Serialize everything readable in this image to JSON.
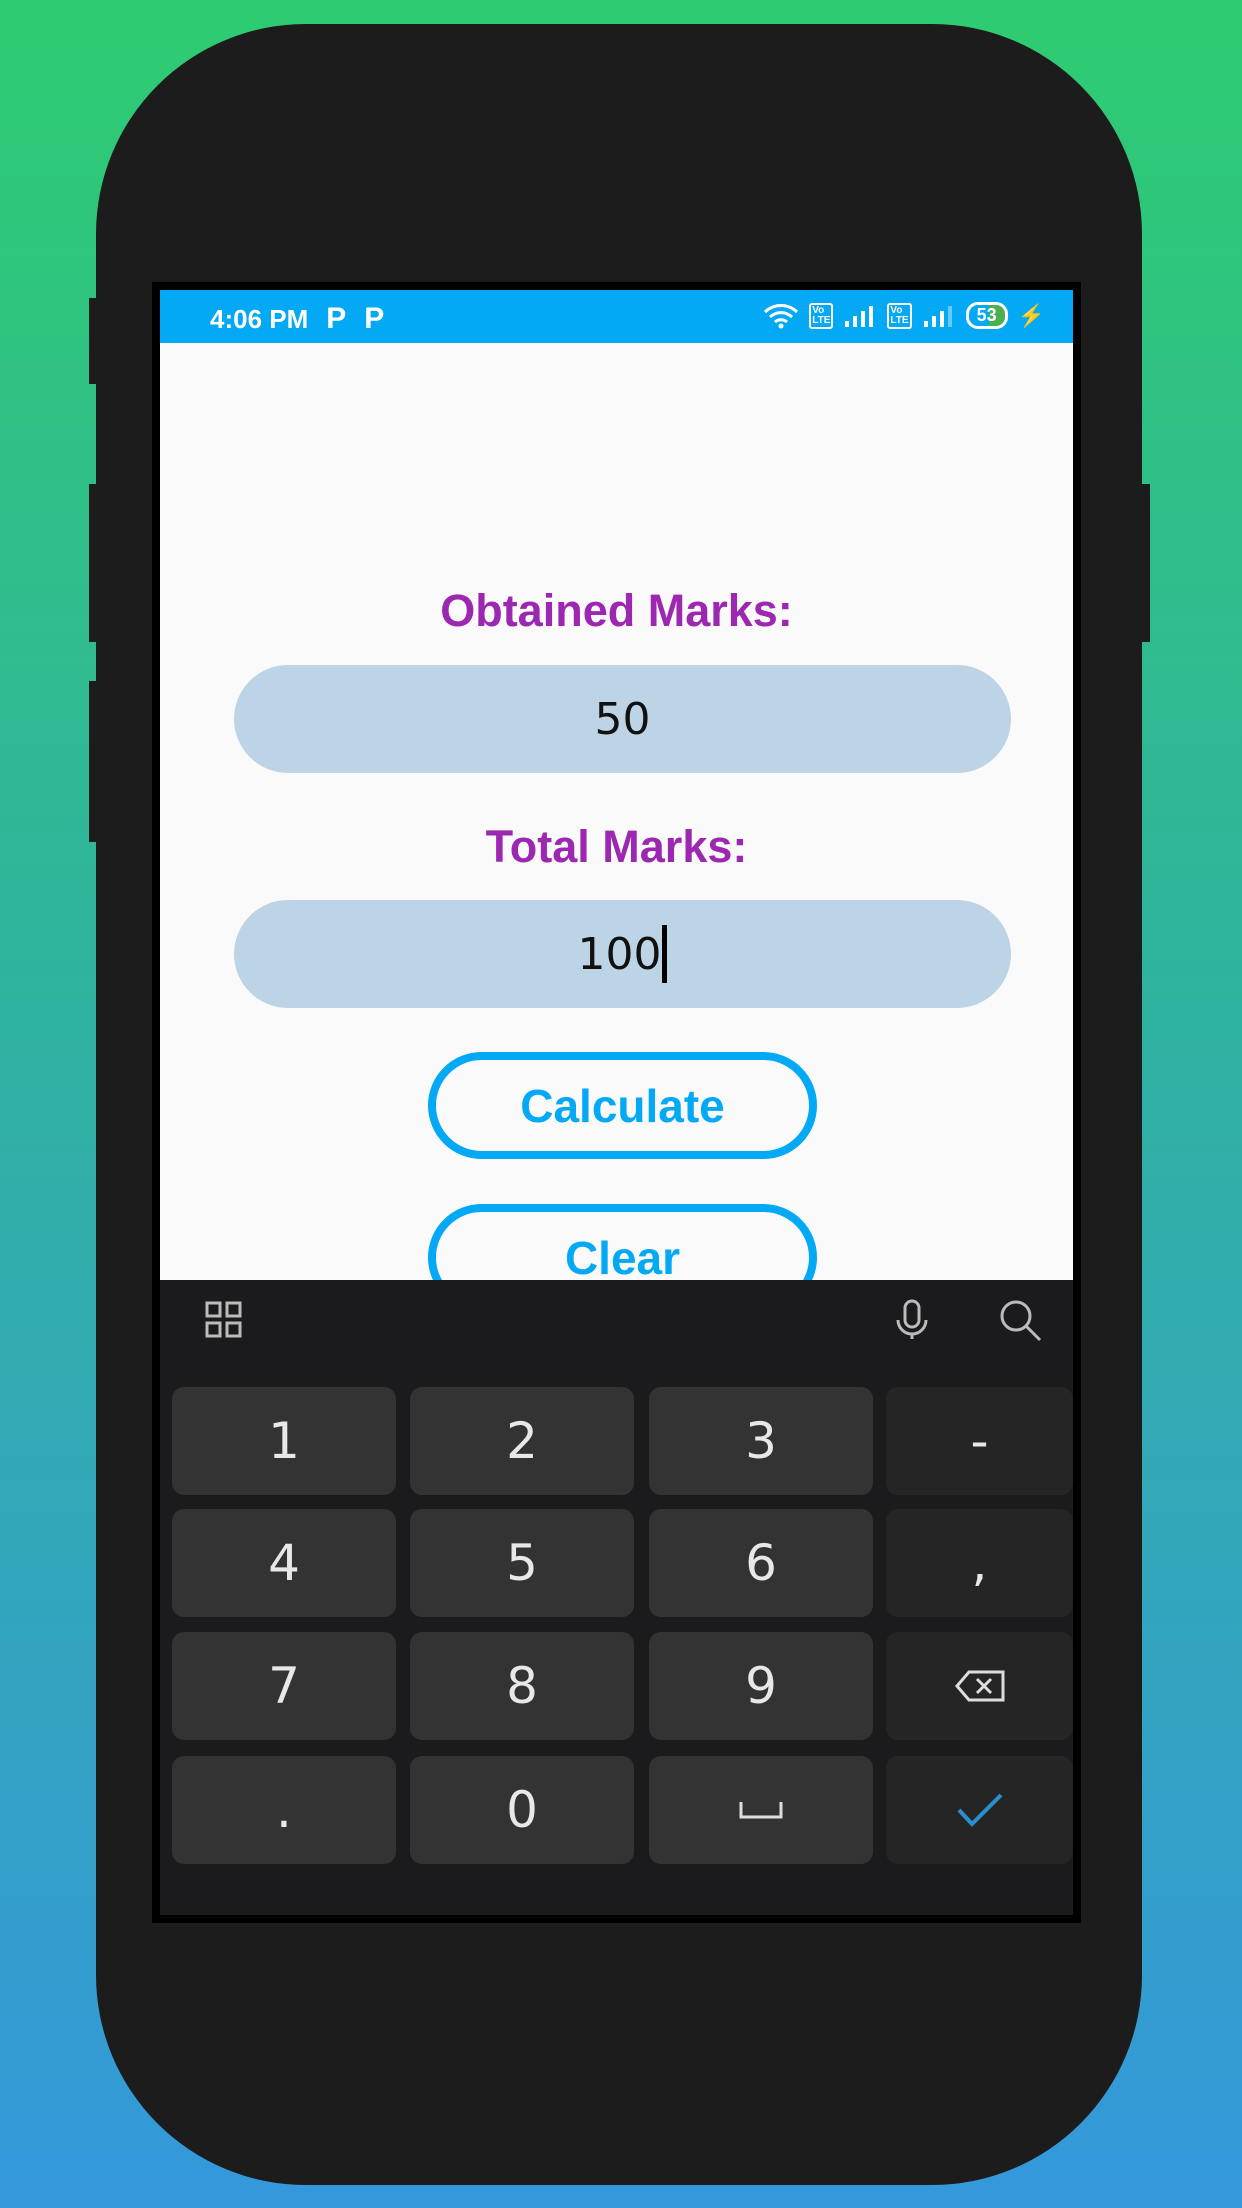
{
  "status_bar": {
    "time": "4:06 PM",
    "notification_icons": [
      "P",
      "P"
    ],
    "battery": "53",
    "icons": [
      "wifi-icon",
      "volte-icon",
      "signal-icon",
      "volte-icon",
      "signal-icon",
      "battery-icon",
      "charging-icon"
    ]
  },
  "form": {
    "obtained_label": "Obtained Marks:",
    "obtained_value": "50",
    "total_label": "Total Marks:",
    "total_value": "100",
    "calculate_label": "Calculate",
    "clear_label": "Clear"
  },
  "keyboard": {
    "rows": [
      [
        "1",
        "2",
        "3",
        "-"
      ],
      [
        "4",
        "5",
        "6",
        ","
      ],
      [
        "7",
        "8",
        "9",
        "⌫"
      ],
      [
        ".",
        "0",
        "␣",
        "✓"
      ]
    ]
  },
  "colors": {
    "accent": "#03a9f4",
    "label": "#9c27b0",
    "field": "#bcd4e6"
  }
}
